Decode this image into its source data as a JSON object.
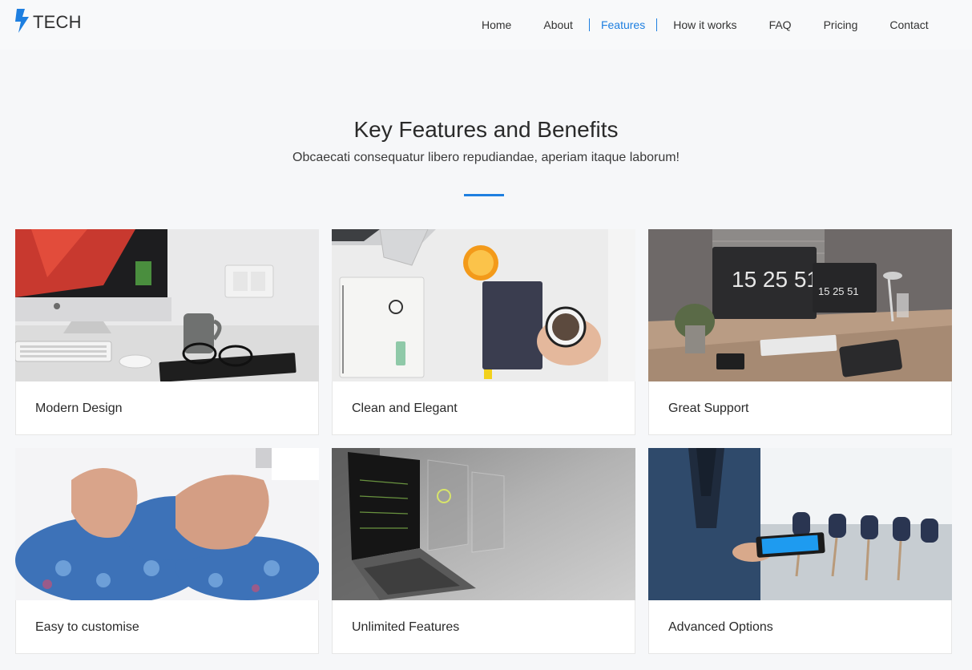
{
  "brand": {
    "name": "TECH",
    "icon": "lightning-bolt-icon",
    "accent": "#1e7fe0"
  },
  "nav": {
    "items": [
      {
        "label": "Home",
        "active": false
      },
      {
        "label": "About",
        "active": false
      },
      {
        "label": "Features",
        "active": true
      },
      {
        "label": "How it works",
        "active": false
      },
      {
        "label": "FAQ",
        "active": false
      },
      {
        "label": "Pricing",
        "active": false
      },
      {
        "label": "Contact",
        "active": false
      }
    ]
  },
  "section": {
    "title": "Key Features and Benefits",
    "subtitle": "Obcaecati consequatur libero repudiandae, aperiam itaque laborum!"
  },
  "features": [
    {
      "label": "Modern Design",
      "image": "imac-desk-photo"
    },
    {
      "label": "Clean and Elegant",
      "image": "notebook-coffee-photo"
    },
    {
      "label": "Great Support",
      "image": "desk-monitor-photo"
    },
    {
      "label": "Easy to customise",
      "image": "puzzle-pieces-photo"
    },
    {
      "label": "Unlimited Features",
      "image": "laptop-screens-photo"
    },
    {
      "label": "Advanced Options",
      "image": "businessman-tablet-photo"
    }
  ],
  "clock_text": "15 25 51"
}
